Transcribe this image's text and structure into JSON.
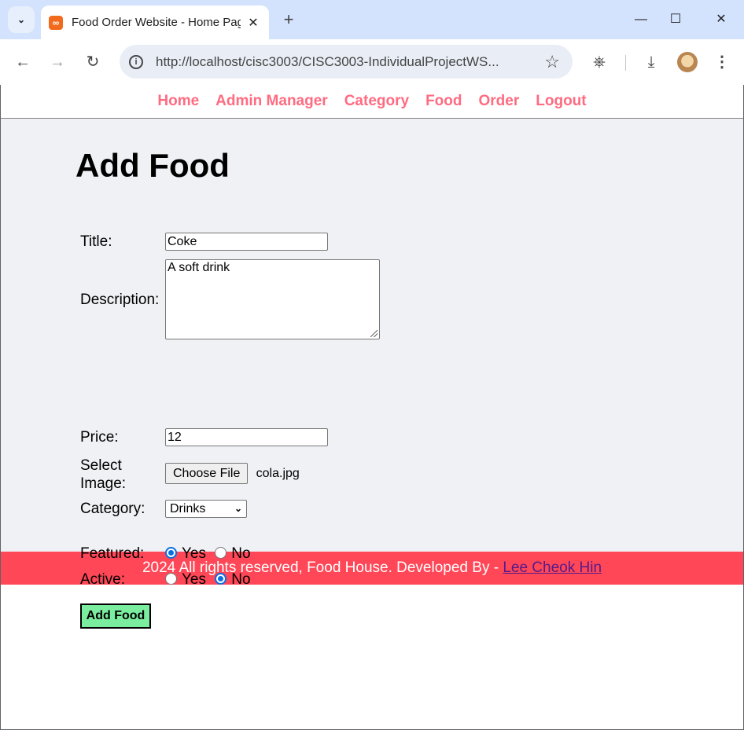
{
  "browser": {
    "tab_title": "Food Order Website - Home Page",
    "url": "http://localhost/cisc3003/CISC3003-IndividualProjectWS..."
  },
  "menu": {
    "items": [
      "Home",
      "Admin Manager",
      "Category",
      "Food",
      "Order",
      "Logout"
    ]
  },
  "main": {
    "heading": "Add Food",
    "form": {
      "title_label": "Title:",
      "title_value": "Coke",
      "description_label": "Description:",
      "description_value": "A soft drink",
      "price_label": "Price:",
      "price_value": "12",
      "image_label_line1": "Select",
      "image_label_line2": "Image:",
      "choose_file_label": "Choose File",
      "file_name": "cola.jpg",
      "category_label": "Category:",
      "category_value": "Drinks",
      "featured_label": "Featured:",
      "featured_yes": "Yes",
      "featured_no": "No",
      "featured_selected": "Yes",
      "active_label": "Active:",
      "active_yes": "Yes",
      "active_no": "No",
      "active_selected": "No",
      "submit_label": "Add Food"
    }
  },
  "footer": {
    "text": "2024 All rights reserved, Food House. Developed By - ",
    "author_link": "Lee Cheok Hin"
  },
  "colors": {
    "menu_link": "#ff6b81",
    "footer_bg": "#ff4757",
    "submit_bg": "#7bed9f",
    "main_bg": "#f0f1f5"
  }
}
